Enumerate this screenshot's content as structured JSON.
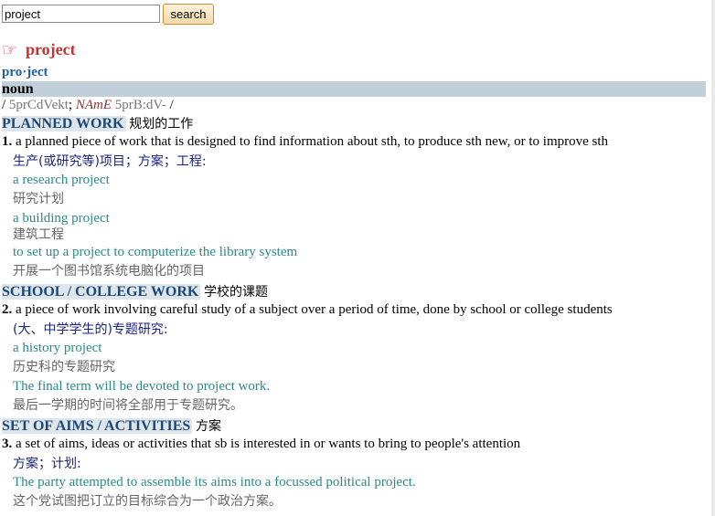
{
  "search": {
    "value": "project",
    "placeholder": "",
    "button_label": "search"
  },
  "entry": {
    "hand_icon": "☞",
    "headword": "project",
    "syllabified": "pro·ject",
    "pos": "noun",
    "pron": {
      "open": "/ ",
      "uk": "5prCdVekt",
      "semi": "; ",
      "region": "NAmE",
      "us": " 5prB:dV-",
      "close": " /"
    },
    "senses": [
      {
        "title": "PLANNED WORK",
        "title_cn": "规划的工作",
        "num": "1.",
        "definition": "a planned piece of work that is designed to find information about sth, to produce sth new, or to improve sth",
        "translation": "生产(或研究等)项目；方案；工程:",
        "examples": [
          {
            "en": "a research project",
            "cn": "研究计划"
          },
          {
            "en": "a building project",
            "cn": "建筑工程"
          },
          {
            "en": "to set up a project to computerize the library system",
            "cn": "开展一个图书馆系统电脑化的项目"
          }
        ]
      },
      {
        "title": "SCHOOL / COLLEGE WORK",
        "title_cn": "学校的课题",
        "num": "2.",
        "definition": "a piece of work involving careful study of a subject over a period of time, done by school or college students",
        "translation": "(大、中学学生的)专题研究:",
        "examples": [
          {
            "en": "a history project",
            "cn": "历史科的专题研究"
          },
          {
            "en": "The final term will be devoted to project work.",
            "cn": "最后一学期的时间将全部用于专题研究。"
          }
        ]
      },
      {
        "title": "SET OF AIMS / ACTIVITIES",
        "title_cn": "方案",
        "num": "3.",
        "definition": "a set of aims, ideas or activities that sb is interested in or wants to bring to people's attention",
        "translation": "方案；计划:",
        "examples": [
          {
            "en": "The party attempted to assemble its aims into a focussed political project.",
            "cn": "这个党试图把订立的目标综合为一个政治方案。"
          }
        ]
      }
    ]
  }
}
